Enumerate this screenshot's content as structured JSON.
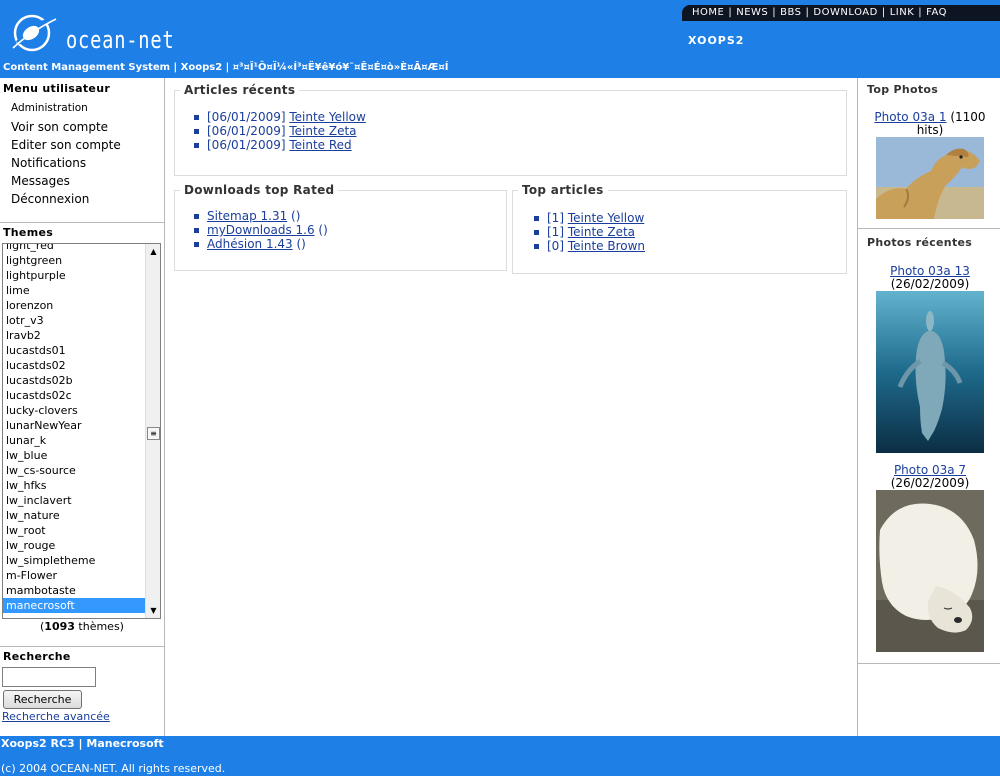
{
  "header": {
    "logo_text": "ocean-net",
    "site_name": "XOOPS2",
    "breadcrumb": "Content Management System | Xoops2 | ¤³¤Î¹Ô¤Ï¼«Í³¤Ë¥ê¥ó¥¯¤Ê¤É¤ò»È¤Ã¤Æ¤Í",
    "nav": [
      "HOME",
      "NEWS",
      "BBS",
      "DOWNLOAD",
      "LINK",
      "FAQ"
    ]
  },
  "user_menu": {
    "title": "Menu utilisateur",
    "items": [
      "Administration",
      "Voir son compte",
      "Editer son compte",
      "Notifications",
      "Messages",
      "Déconnexion"
    ]
  },
  "themes": {
    "title": "Themes",
    "options": [
      "light_red",
      "lightgreen",
      "lightpurple",
      "lime",
      "lorenzon",
      "lotr_v3",
      "lravb2",
      "lucastds01",
      "lucastds02",
      "lucastds02b",
      "lucastds02c",
      "lucky-clovers",
      "lunarNewYear",
      "lunar_k",
      "lw_blue",
      "lw_cs-source",
      "lw_hfks",
      "lw_inclavert",
      "lw_nature",
      "lw_root",
      "lw_rouge",
      "lw_simpletheme",
      "m-Flower",
      "mambotaste",
      "manecrosoft"
    ],
    "selected": "manecrosoft",
    "count_prefix": "(",
    "count": "1093",
    "count_suffix": " thèmes)"
  },
  "search": {
    "title": "Recherche",
    "button": "Recherche",
    "advanced": "Recherche avancée"
  },
  "recent_articles": {
    "title": "Articles récents",
    "items": [
      {
        "date": "[06/01/2009]",
        "title": "Teinte Yellow"
      },
      {
        "date": "[06/01/2009]",
        "title": "Teinte Zeta"
      },
      {
        "date": "[06/01/2009]",
        "title": "Teinte Red"
      }
    ]
  },
  "downloads_top": {
    "title": "Downloads top Rated",
    "items": [
      {
        "name": "Sitemap 1.31",
        "suffix": " ()"
      },
      {
        "name": "myDownloads 1.6",
        "suffix": " ()"
      },
      {
        "name": "Adhésion 1.43",
        "suffix": " ()"
      }
    ]
  },
  "top_articles": {
    "title": "Top articles",
    "items": [
      {
        "count": "[1]",
        "title": "Teinte Yellow"
      },
      {
        "count": "[1]",
        "title": "Teinte Zeta"
      },
      {
        "count": "[0]",
        "title": "Teinte Brown"
      }
    ]
  },
  "top_photos": {
    "title": "Top Photos",
    "photo": {
      "title": "Photo 03a 1",
      "meta": " (1100 hits)"
    }
  },
  "recent_photos": {
    "title": "Photos récentes",
    "items": [
      {
        "title": "Photo 03a 13",
        "meta": "(26/02/2009)"
      },
      {
        "title": "Photo 03a 7",
        "meta": " (26/02/2009)"
      }
    ]
  },
  "footer": {
    "line1": "Xoops2 RC3 | Manecrosoft",
    "line2": "(c) 2004 OCEAN-NET. All rights reserved."
  },
  "colors": {
    "brand_blue": "#1e7fe6",
    "nav_bar": "#0d1422",
    "link": "#1a3e9c",
    "selection": "#3399ff"
  }
}
